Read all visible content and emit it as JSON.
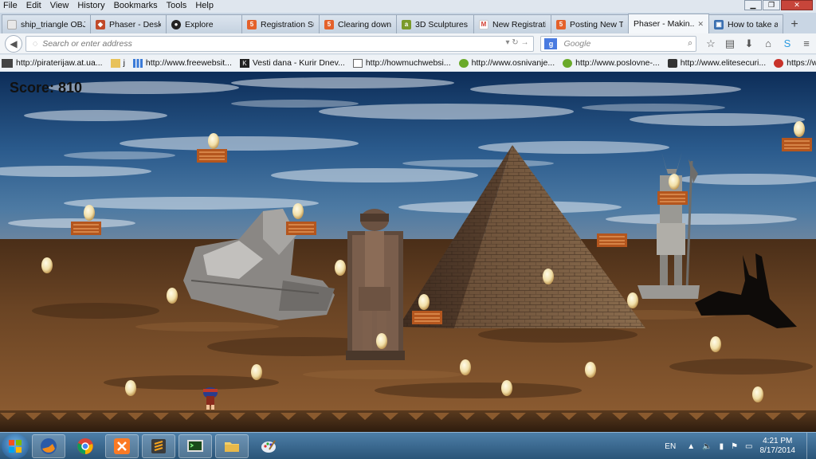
{
  "menu": [
    "File",
    "Edit",
    "View",
    "History",
    "Bookmarks",
    "Tools",
    "Help"
  ],
  "tabs": [
    {
      "label": "ship_triangle OBJ/lo...",
      "icon": "page-icon",
      "color": "#e8e8e8"
    },
    {
      "label": "Phaser - Deskt...",
      "icon": "phaser-icon",
      "color": "#c14a2a"
    },
    {
      "label": "Explore",
      "icon": "github-icon",
      "color": "#222222"
    },
    {
      "label": "Registration Su...",
      "icon": "html5-icon",
      "color": "#e4612b"
    },
    {
      "label": "Clearing down ...",
      "icon": "html5-icon",
      "color": "#e4612b"
    },
    {
      "label": "3D Sculptures ...",
      "icon": "sculpture-icon",
      "color": "#7a9a2a"
    },
    {
      "label": "New Registrati...",
      "icon": "gmail-icon",
      "color": "#d23f31"
    },
    {
      "label": "Posting New T...",
      "icon": "html5-icon",
      "color": "#e4612b"
    },
    {
      "label": "Phaser - Makin...",
      "icon": "none",
      "color": "#ffffff",
      "active": true
    },
    {
      "label": "How to take a s...",
      "icon": "page-icon",
      "color": "#3a6fb0"
    }
  ],
  "nav": {
    "url_placeholder": "Search or enter address",
    "search_placeholder": "Google",
    "search_engine": "g-icon"
  },
  "bookmarks": [
    {
      "label": "http://piraterijaw.at.ua...",
      "icon": "film-icon"
    },
    {
      "label": "j",
      "icon": "folder-icon"
    },
    {
      "label": "http://www.freewebsit...",
      "icon": "bars-icon"
    },
    {
      "label": "Vesti dana - Kurir Dnev...",
      "icon": "k-icon"
    },
    {
      "label": "http://howmuchwebsi...",
      "icon": "blank-icon"
    },
    {
      "label": "http://www.osnivanje...",
      "icon": "green-icon"
    },
    {
      "label": "http://www.poslovne-...",
      "icon": "green-icon"
    },
    {
      "label": "http://www.elitesecuri...",
      "icon": "es-icon"
    },
    {
      "label": "https://www.off-shore...",
      "icon": "red-icon"
    }
  ],
  "game": {
    "score_text": "Score: 810"
  },
  "taskbar": {
    "apps": [
      "firefox-icon",
      "chrome-icon",
      "xampp-icon",
      "sublime-icon",
      "terminal-icon",
      "folder-icon",
      "paint-icon"
    ],
    "lang": "EN",
    "time": "4:21 PM",
    "date": "8/17/2014"
  }
}
